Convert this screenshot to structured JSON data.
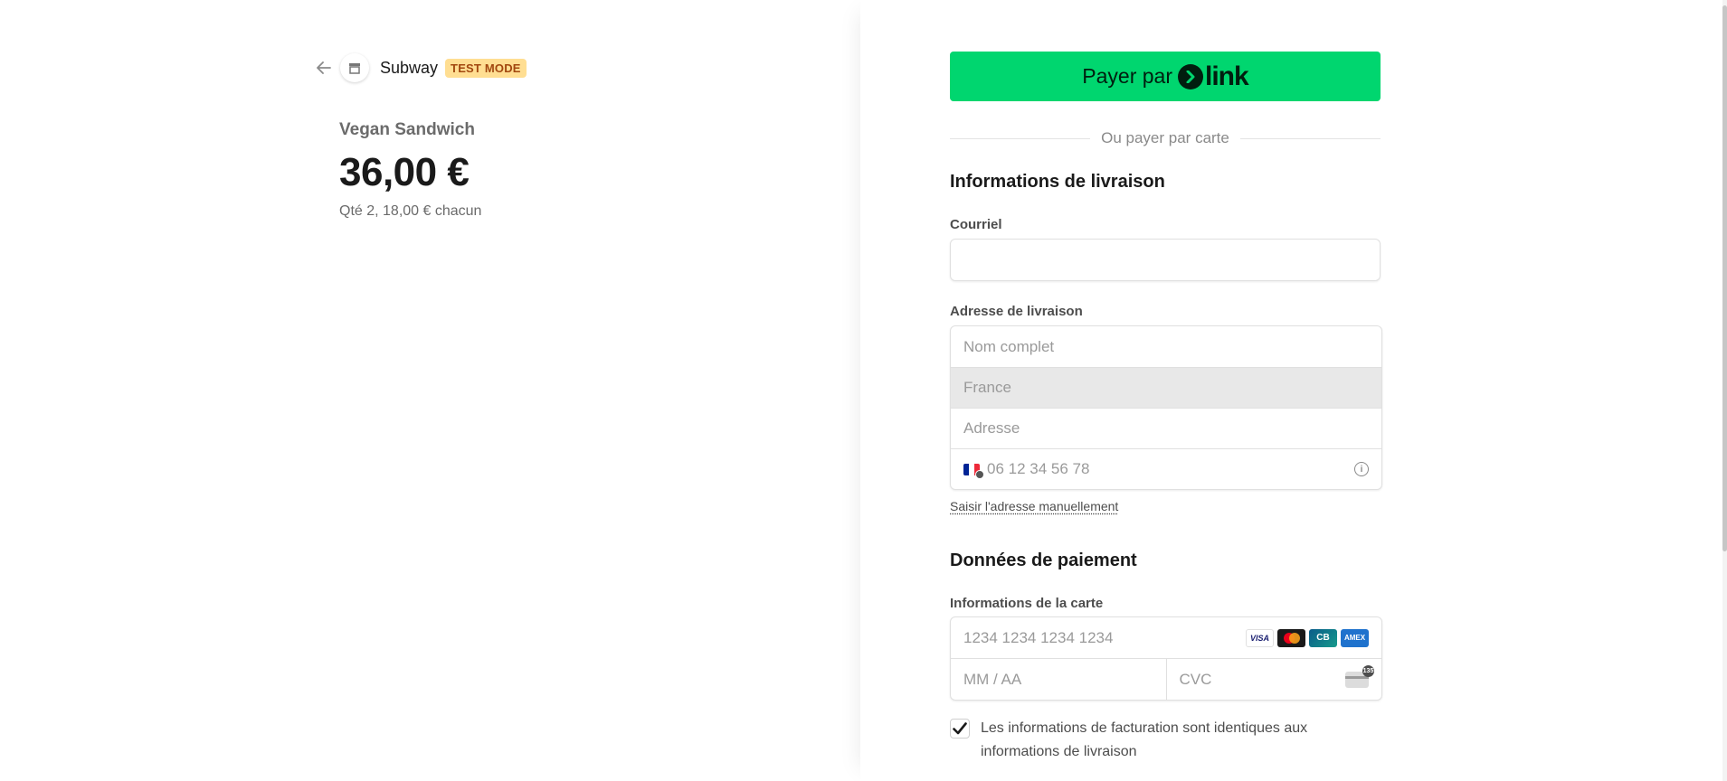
{
  "merchant": {
    "name": "Subway",
    "badge": "TEST MODE"
  },
  "product": {
    "name": "Vegan Sandwich",
    "total": "36,00 €",
    "quantity_line": "Qté 2, 18,00 € chacun"
  },
  "link_pay": {
    "label": "Payer par",
    "brand": "link",
    "color": "#00d66f"
  },
  "divider_text": "Ou payer par carte",
  "shipping": {
    "title": "Informations de livraison",
    "email_label": "Courriel",
    "email_value": "",
    "address_label": "Adresse de livraison",
    "name_placeholder": "Nom complet",
    "country": "France",
    "address_placeholder": "Adresse",
    "phone_placeholder": "06 12 34 56 78",
    "manual_link": "Saisir l'adresse manuellement"
  },
  "payment": {
    "title": "Données de paiement",
    "card_label": "Informations de la carte",
    "card_number_placeholder": "1234 1234 1234 1234",
    "expiry_placeholder": "MM / AA",
    "cvc_placeholder": "CVC",
    "cvc_badge": "135",
    "brands": {
      "visa": "VISA",
      "cb": "CB",
      "amex": "AMEX"
    },
    "billing_same_label": "Les informations de facturation sont identiques aux informations de livraison",
    "billing_same_checked": true
  }
}
